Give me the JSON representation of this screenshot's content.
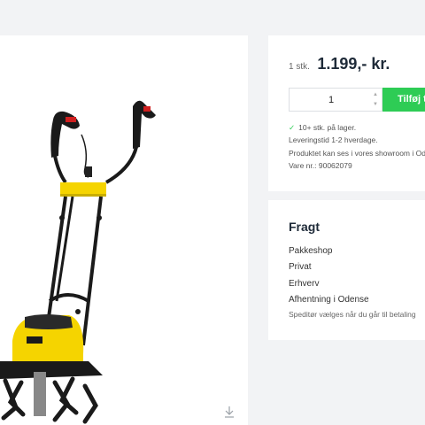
{
  "product_image": {
    "subject": "electric tiller with yellow housing and black handles",
    "colors": {
      "accent": "#f5d400",
      "frame": "#1a1a1a"
    },
    "download_icon": "download-icon"
  },
  "price_card": {
    "qty_prefix": "1 stk.",
    "price": "1.199,- kr.",
    "quantity_value": "1",
    "add_to_cart_label": "Tilføj ti",
    "stock_icon": "checkmark-icon",
    "stock_text": "10+ stk. på lager.",
    "delivery_text": "Leveringstid 1-2 hverdage.",
    "showroom_text": "Produktet kan ses i vores showroom i Od",
    "item_number_text": "Vare nr.: 90062079",
    "colors": {
      "button": "#2ecc55",
      "check": "#2ecc55",
      "price": "#1e2a38"
    }
  },
  "freight": {
    "title": "Fragt",
    "options": [
      "Pakkeshop",
      "Privat",
      "Erhverv",
      "Afhentning i Odense"
    ],
    "note": "Speditør vælges når du går til betaling"
  }
}
